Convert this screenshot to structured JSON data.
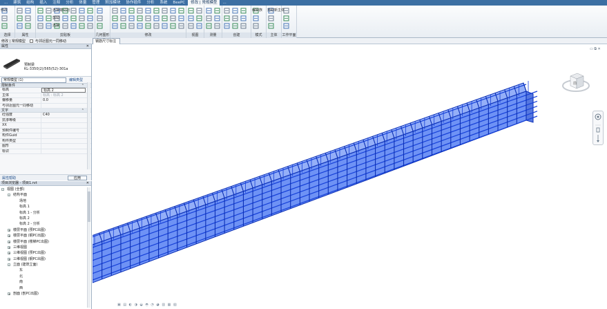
{
  "menu_tabs": [
    "...",
    "建筑",
    "结构",
    "插入",
    "注释",
    "分析",
    "体量",
    "管理",
    "附加模块",
    "协作插件",
    "分析",
    "系统",
    "BeePC",
    "修改 | 常规模型",
    "..."
  ],
  "menu_active_index": 13,
  "ribbon": {
    "groups": [
      {
        "title": "选择",
        "items": [
          "修改"
        ]
      },
      {
        "title": "属性",
        "items": []
      },
      {
        "title": "剪贴板",
        "items": [
          "连接端切割",
          "剪切",
          "连接"
        ]
      },
      {
        "title": "几何图形",
        "items": []
      },
      {
        "title": "修改",
        "items": []
      },
      {
        "title": "视图",
        "items": []
      },
      {
        "title": "测量",
        "items": []
      },
      {
        "title": "创建",
        "items": []
      },
      {
        "title": "模式",
        "items": [
          "编辑族"
        ]
      },
      {
        "title": "主体",
        "items": [
          "拾取新主体"
        ]
      },
      {
        "title": "工作平面",
        "items": []
      }
    ]
  },
  "options_bar": {
    "label": "修改 | 常规模型",
    "checkbox_label": "与邻近图元一同移动"
  },
  "view_tab": "钢筋尺寸标注",
  "properties": {
    "title": "属性",
    "close": "✕",
    "type_name_1": "预制梁",
    "type_name_2": "KL-3350(2)/565(52)-301a",
    "type_selector": "常规模型 (1)",
    "edit_type": "编辑类型",
    "sections": [
      {
        "name": "限制条件",
        "rows": [
          {
            "key": "标高",
            "value": "标高 2",
            "style": "edit"
          },
          {
            "key": "主体",
            "value": "标高 : 标高 2",
            "style": "gray"
          },
          {
            "key": "偏移量",
            "value": "0.0",
            "style": ""
          },
          {
            "key": "与邻近图元一同移动",
            "value": "",
            "style": ""
          }
        ]
      },
      {
        "name": "文字",
        "rows": [
          {
            "key": "砼强度",
            "value": "C40",
            "style": ""
          },
          {
            "key": "抗渗等级",
            "value": "",
            "style": ""
          },
          {
            "key": "XX",
            "value": "",
            "style": ""
          },
          {
            "key": "预制件编号",
            "value": "",
            "style": ""
          },
          {
            "key": "构件Guid",
            "value": "",
            "style": ""
          },
          {
            "key": "构件类型",
            "value": "",
            "style": ""
          },
          {
            "key": "图形",
            "value": "",
            "style": ""
          },
          {
            "key": "标识",
            "value": "",
            "style": ""
          }
        ]
      }
    ],
    "help_link": "属性帮助",
    "apply": "应用"
  },
  "browser": {
    "title": "项目浏览器 - 项目1.rvt",
    "close": "✕",
    "nodes": [
      {
        "label": "视图 (全部)",
        "level": 0,
        "exp": "-"
      },
      {
        "label": "结构平面",
        "level": 1,
        "exp": "-"
      },
      {
        "label": "场地",
        "level": 2,
        "exp": ""
      },
      {
        "label": "标高 1",
        "level": 2,
        "exp": ""
      },
      {
        "label": "标高 1 - 分析",
        "level": 2,
        "exp": ""
      },
      {
        "label": "标高 2",
        "level": 2,
        "exp": ""
      },
      {
        "label": "标高 2 - 分析",
        "level": 2,
        "exp": ""
      },
      {
        "label": "楼层平面 (预PC出图)",
        "level": 1,
        "exp": "+"
      },
      {
        "label": "楼层平面 (钢PC出图)",
        "level": 1,
        "exp": "+"
      },
      {
        "label": "楼层平面 (楼梯PC出图)",
        "level": 1,
        "exp": "+"
      },
      {
        "label": "三维视图",
        "level": 1,
        "exp": "+"
      },
      {
        "label": "三维视图 (预PC出图)",
        "level": 1,
        "exp": "+"
      },
      {
        "label": "三维视图 (钢PC出图)",
        "level": 1,
        "exp": "+"
      },
      {
        "label": "立面 (建筑立面)",
        "level": 1,
        "exp": "-"
      },
      {
        "label": "东",
        "level": 2,
        "exp": ""
      },
      {
        "label": "北",
        "level": 2,
        "exp": ""
      },
      {
        "label": "南",
        "level": 2,
        "exp": ""
      },
      {
        "label": "西",
        "level": 2,
        "exp": ""
      },
      {
        "label": "剖面 (剖PC出图)",
        "level": 1,
        "exp": "+"
      }
    ]
  },
  "canvas": {
    "window_controls": "▭ ⧉ ✕",
    "viewcube_label": "前"
  },
  "colors": {
    "menubar": "#3c6fa3",
    "beam_fill": "#3d6df2",
    "beam_edge": "#0b2fb5",
    "beam_bar": "#1540d8"
  }
}
